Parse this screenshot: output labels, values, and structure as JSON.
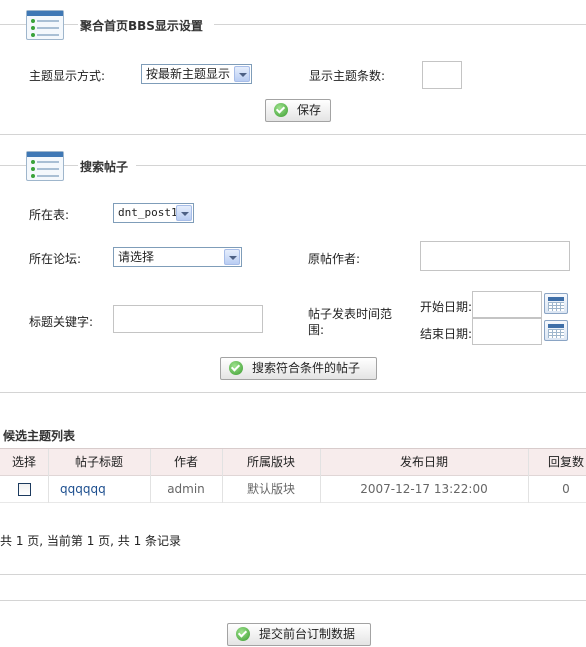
{
  "section1": {
    "title": "聚合首页BBS显示设置",
    "display_mode_label": "主题显示方式:",
    "display_mode_value": "按最新主题显示",
    "count_label": "显示主题条数:",
    "count_value": "",
    "save_button": "保存"
  },
  "section2": {
    "title": "搜索帖子",
    "table_label": "所在表:",
    "table_value": "dnt_post1",
    "forum_label": "所在论坛:",
    "forum_value": "请选择",
    "author_label": "原帖作者:",
    "keyword_label": "标题关键字:",
    "time_range_label_line1": "帖子发表时间范",
    "time_range_label_line2": "围:",
    "start_date_label": "开始日期:",
    "end_date_label": "结束日期:",
    "search_button": "搜索符合条件的帖子"
  },
  "list": {
    "title": "候选主题列表",
    "columns": [
      "选择",
      "帖子标题",
      "作者",
      "所属版块",
      "发布日期",
      "回复数"
    ],
    "rows": [
      {
        "title": "qqqqqq",
        "author": "admin",
        "board": "默认版块",
        "date": "2007-12-17 13:22:00",
        "replies": "0"
      }
    ],
    "pagination": "共 1 页, 当前第 1 页, 共 1 条记录"
  },
  "submit_button": "提交前台订制数据",
  "colors": {
    "header_bg": "#f7ecec",
    "link": "#1d4f8f",
    "border": "#d4d4d4"
  }
}
